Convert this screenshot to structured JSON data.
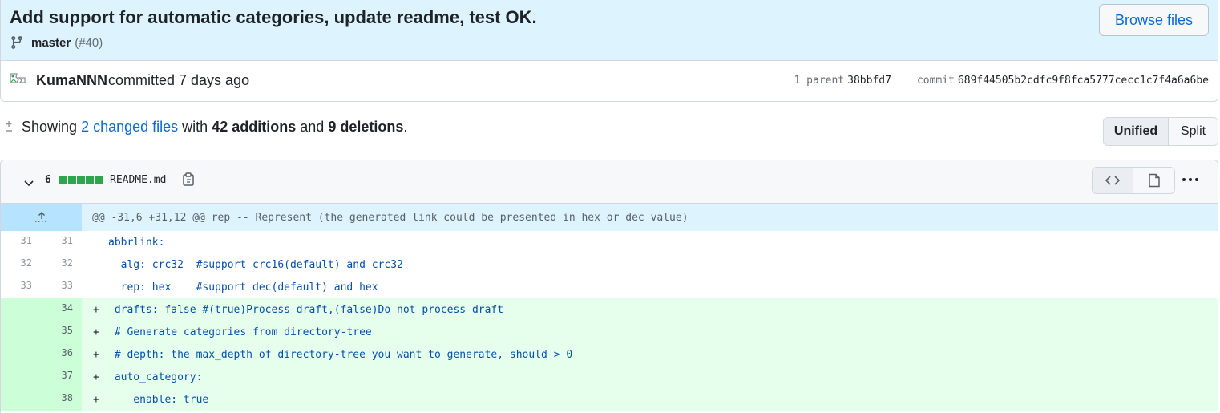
{
  "commit": {
    "title": "Add support for automatic categories, update readme, test OK.",
    "branch": "master",
    "pr": "(#40)",
    "browse_label": "Browse files",
    "author": "KumaNNN",
    "action": "committed 7 days ago",
    "parent_label": "1 parent",
    "parent_sha": "38bbfd7",
    "commit_label": "commit",
    "commit_sha": "689f44505b2cdfc9f8fca5777cecc1c7f4a6a6be"
  },
  "summary": {
    "showing": "Showing",
    "changed_files": "2 changed files",
    "with": "with",
    "additions": "42 additions",
    "and": "and",
    "deletions": "9 deletions",
    "period": "."
  },
  "view_toggle": {
    "unified": "Unified",
    "split": "Split",
    "selected": "Unified"
  },
  "file": {
    "change_count": "6",
    "filename": "README.md",
    "stat_blocks": 5,
    "hunk_header": "@@ -31,6 +31,12 @@ rep -- Represent (the generated link could be presented in hex or dec value)",
    "lines": [
      {
        "old": "31",
        "new": "31",
        "type": "context",
        "marker": "",
        "text": "abbrlink:"
      },
      {
        "old": "32",
        "new": "32",
        "type": "context",
        "marker": "",
        "text": "  alg: crc32  #support crc16(default) and crc32"
      },
      {
        "old": "33",
        "new": "33",
        "type": "context",
        "marker": "",
        "text": "  rep: hex    #support dec(default) and hex"
      },
      {
        "old": "",
        "new": "34",
        "type": "add",
        "marker": "+",
        "text": " drafts: false #(true)Process draft,(false)Do not process draft"
      },
      {
        "old": "",
        "new": "35",
        "type": "add",
        "marker": "+",
        "text": " # Generate categories from directory-tree"
      },
      {
        "old": "",
        "new": "36",
        "type": "add",
        "marker": "+",
        "text": " # depth: the max_depth of directory-tree you want to generate, should > 0"
      },
      {
        "old": "",
        "new": "37",
        "type": "add",
        "marker": "+",
        "text": " auto_category:"
      },
      {
        "old": "",
        "new": "38",
        "type": "add",
        "marker": "+",
        "text": "    enable: true"
      }
    ]
  },
  "colors": {
    "accent": "#0969da",
    "add_bg": "#e6ffec",
    "add_num_bg": "#ccffd8",
    "hunk_bg": "#ddf4ff",
    "header_bg": "#ddf4ff",
    "stat_green": "#2da44e"
  },
  "icons": {
    "branch": "git-branch-icon",
    "avatar": "broken-avatar-icon",
    "diff": "diff-icon",
    "chevron": "chevron-down-icon",
    "copy": "copy-icon",
    "code": "code-icon",
    "file": "file-icon",
    "kebab": "kebab-horizontal-icon",
    "expand": "unfold-up-icon"
  }
}
